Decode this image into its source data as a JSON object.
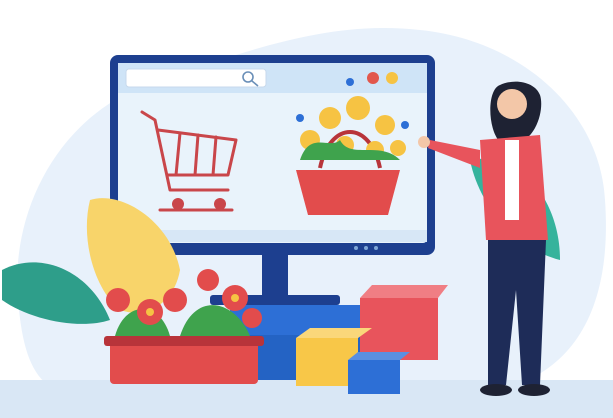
{
  "illustration": {
    "search": {
      "placeholder": "",
      "icon": "search-icon"
    },
    "window_dots": [
      "#e2574c",
      "#f6c343"
    ],
    "colors": {
      "monitor_frame": "#1d3f8f",
      "screen_bg": "#e9f3fb",
      "accent_red": "#e24c4c",
      "jacket": "#e8545c",
      "pants": "#1e2c58",
      "box_yellow": "#f8c748",
      "box_blue": "#2d6fd6",
      "leaf_green": "#2e9e8a"
    },
    "icons": [
      "shopping-cart-icon",
      "search-icon",
      "flower-basket-icon",
      "potted-flowers-icon",
      "gift-box-icon"
    ]
  }
}
